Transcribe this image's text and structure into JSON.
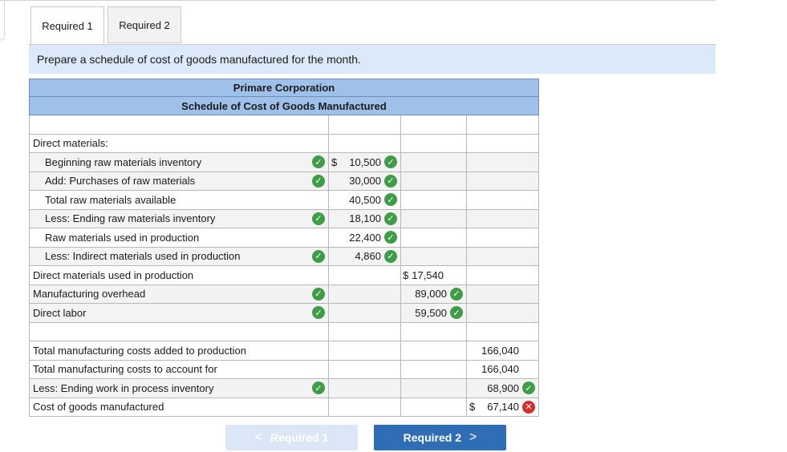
{
  "tabs": [
    {
      "label": "Required 1",
      "active": true
    },
    {
      "label": "Required 2",
      "active": false
    }
  ],
  "instruction": "Prepare a schedule of cost of goods manufactured for the month.",
  "schedule": {
    "company": "Primare Corporation",
    "title": "Schedule of Cost of Goods Manufactured",
    "rows": {
      "dm_header": "Direct materials:",
      "beg_rm": {
        "label": "Beginning raw materials inventory",
        "currency": "$",
        "value": "10,500"
      },
      "purchases": {
        "label": "Add: Purchases of raw materials",
        "value": "30,000"
      },
      "total_rm": {
        "label": "Total raw materials available",
        "value": "40,500"
      },
      "end_rm": {
        "label": "Less: Ending raw materials inventory",
        "value": "18,100"
      },
      "rm_used": {
        "label": "Raw materials used in production",
        "value": "22,400"
      },
      "indirect": {
        "label": "Less: Indirect materials used in production",
        "value": "4,860"
      },
      "dm_used": {
        "label": "Direct materials used in production",
        "currency": "$",
        "value": "17,540"
      },
      "overhead": {
        "label": "Manufacturing overhead",
        "value": "89,000"
      },
      "labor": {
        "label": "Direct labor",
        "value": "59,500"
      },
      "total_added": {
        "label": "Total manufacturing costs added to production",
        "value": "166,040"
      },
      "total_account": {
        "label": "Total manufacturing costs to account for",
        "value": "166,040"
      },
      "end_wip": {
        "label": "Less: Ending work in process inventory",
        "value": "68,900"
      },
      "cogm": {
        "label": "Cost of goods manufactured",
        "currency": "$",
        "value": "67,140"
      }
    }
  },
  "icons": {
    "correct": "check-icon",
    "incorrect": "x-icon"
  },
  "colors": {
    "correct": "#3f9c47",
    "incorrect": "#d32f2f",
    "header": "#9fc1e9",
    "next_button": "#2f6db5"
  },
  "nav": {
    "prev_label": "Required 1",
    "next_label": "Required 2",
    "prev_arrow": "<",
    "next_arrow": ">"
  }
}
